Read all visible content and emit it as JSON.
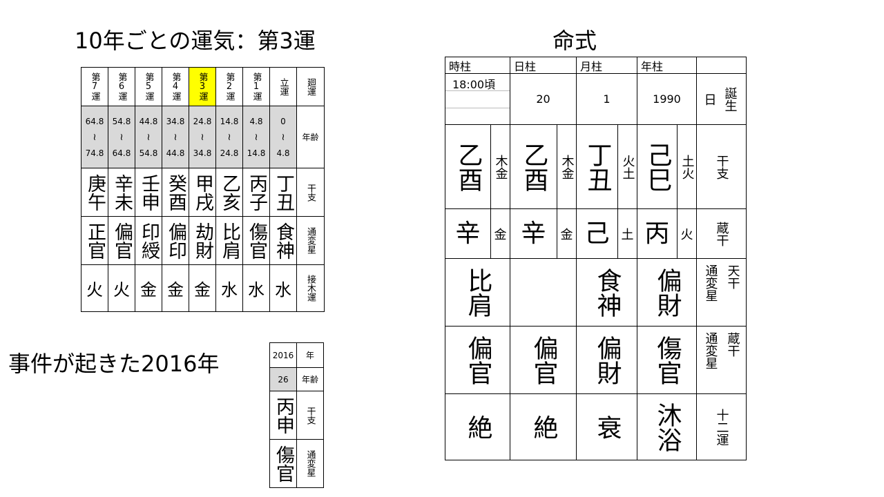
{
  "titles": {
    "luck": "10年ごとの運気：第3運",
    "event": "事件が起きた2016年",
    "chart": "命式"
  },
  "luck_table": {
    "columns": [
      {
        "label": "第7運",
        "start": "64.8",
        "end": "74.8",
        "kanshi": "庚午",
        "tsuhen": "正官",
        "element": "火"
      },
      {
        "label": "第6運",
        "start": "54.8",
        "end": "64.8",
        "kanshi": "辛未",
        "tsuhen": "偏官",
        "element": "火"
      },
      {
        "label": "第5運",
        "start": "44.8",
        "end": "54.8",
        "kanshi": "壬申",
        "tsuhen": "印綬",
        "element": "金"
      },
      {
        "label": "第4運",
        "start": "34.8",
        "end": "44.8",
        "kanshi": "癸酉",
        "tsuhen": "偏印",
        "element": "金"
      },
      {
        "label": "第3運",
        "start": "24.8",
        "end": "34.8",
        "kanshi": "甲戌",
        "tsuhen": "劫財",
        "element": "金",
        "highlight": true
      },
      {
        "label": "第2運",
        "start": "14.8",
        "end": "24.8",
        "kanshi": "乙亥",
        "tsuhen": "比肩",
        "element": "水"
      },
      {
        "label": "第1運",
        "start": "4.8",
        "end": "14.8",
        "kanshi": "丙子",
        "tsuhen": "傷官",
        "element": "水"
      },
      {
        "label": "立運",
        "start": "0",
        "end": "4.8",
        "kanshi": "丁丑",
        "tsuhen": "食神",
        "element": "水"
      }
    ],
    "wave": "≀",
    "row_headers": {
      "label": "廻運",
      "age": "年齢",
      "kanshi": "干支",
      "tsuhen": "通変星",
      "element": "接木運"
    }
  },
  "event_table": {
    "year": "2016",
    "year_label": "年",
    "age": "26",
    "age_label": "年齢",
    "kanshi": "丙申",
    "kanshi_label": "干支",
    "tsuhen": "傷官",
    "tsuhen_label": "通変星"
  },
  "meishiki": {
    "headers": [
      "時柱",
      "日柱",
      "月柱",
      "年柱"
    ],
    "birth": {
      "time": "18:00頃",
      "day": "20",
      "month": "1",
      "year": "1990",
      "label_a": "日",
      "label_b": "誕生"
    },
    "kanshi": [
      {
        "chars": "乙酉",
        "elements": "木金"
      },
      {
        "chars": "乙酉",
        "elements": "木金"
      },
      {
        "chars": "丁丑",
        "elements": "火土"
      },
      {
        "chars": "己巳",
        "elements": "土火"
      }
    ],
    "kanshi_label": "干支",
    "zokan": [
      {
        "char": "辛",
        "element": "金"
      },
      {
        "char": "辛",
        "element": "金"
      },
      {
        "char": "己",
        "element": "土"
      },
      {
        "char": "丙",
        "element": "火"
      }
    ],
    "zokan_label": "蔵干",
    "tenkan_tsuhen": [
      "比肩",
      "",
      "食神",
      "偏財"
    ],
    "tenkan_label_a": "通変星",
    "tenkan_label_b": "天干",
    "zokan_tsuhen": [
      "偏官",
      "偏官",
      "偏財",
      "傷官"
    ],
    "zokan_tsuhen_label_a": "通変星",
    "zokan_tsuhen_label_b": "蔵干",
    "juniun": [
      "絶",
      "絶",
      "衰",
      "沐浴"
    ],
    "juniun_label": "十二運"
  }
}
